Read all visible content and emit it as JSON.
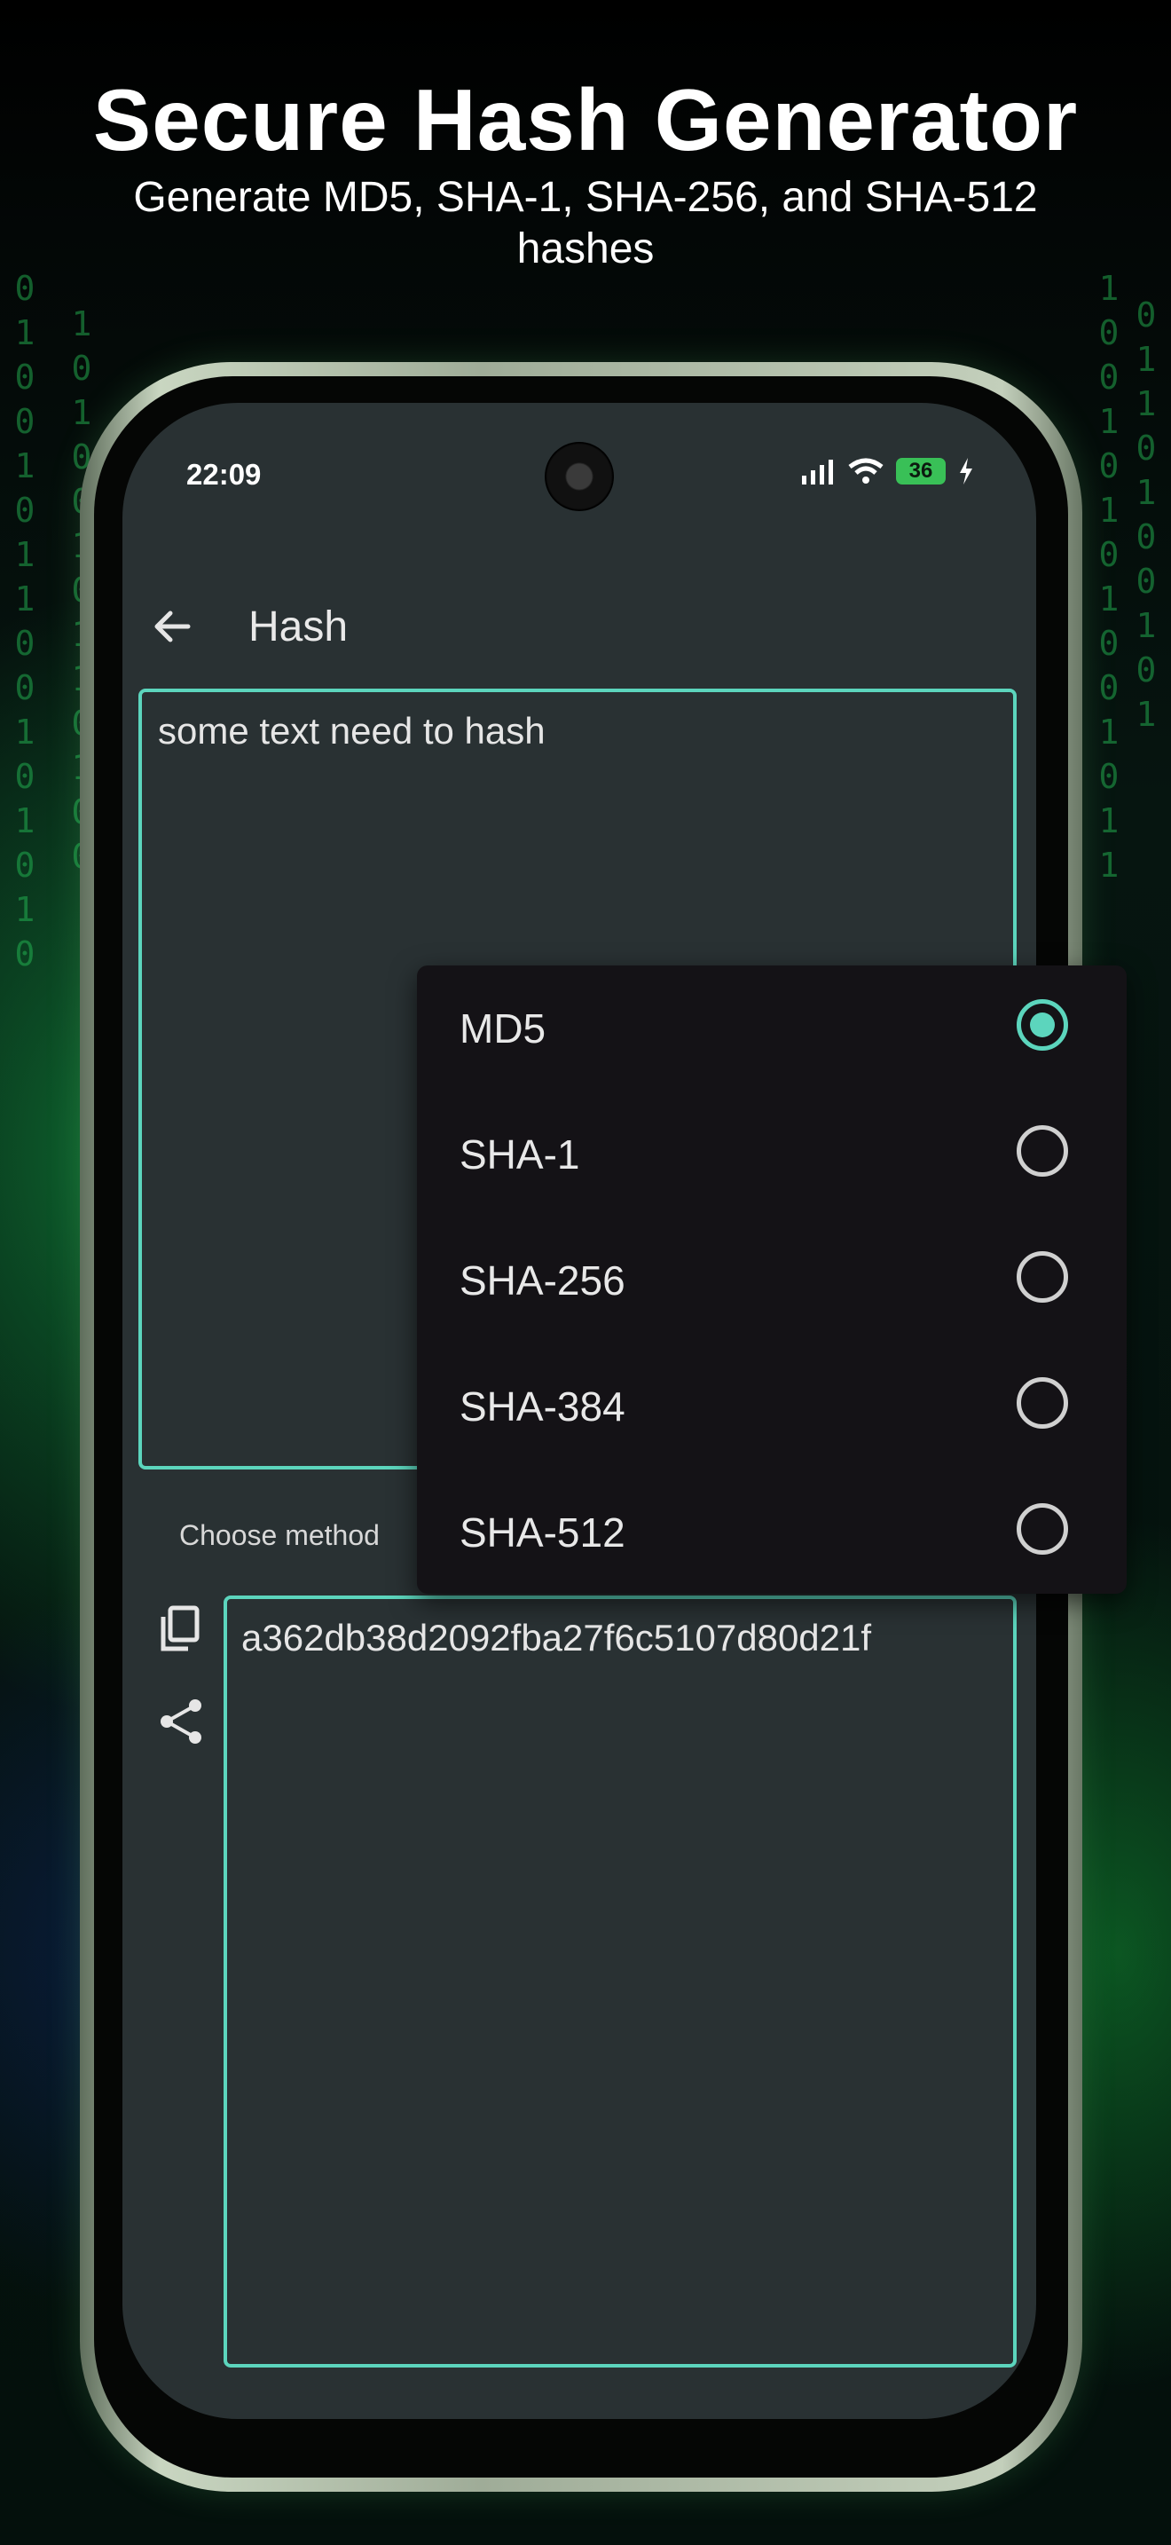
{
  "hero": {
    "title": "Secure Hash Generator",
    "subtitle": "Generate MD5, SHA-1, SHA-256, and SHA-512 hashes"
  },
  "status_bar": {
    "time": "22:09",
    "battery": "36"
  },
  "app_bar": {
    "back_icon": "arrow-back-icon",
    "title": "Hash"
  },
  "input": {
    "value": "some text need to hash"
  },
  "method": {
    "label": "Choose method",
    "options": [
      "MD5",
      "SHA-1",
      "SHA-256",
      "SHA-384",
      "SHA-512"
    ],
    "selected": "MD5"
  },
  "output": {
    "value": "a362db38d2092fba27f6c5107d80d21f",
    "copy_icon": "copy-icon",
    "share_icon": "share-icon"
  },
  "colors": {
    "accent": "#5cd5bd",
    "screen_bg": "#293133",
    "menu_bg": "#141216"
  }
}
